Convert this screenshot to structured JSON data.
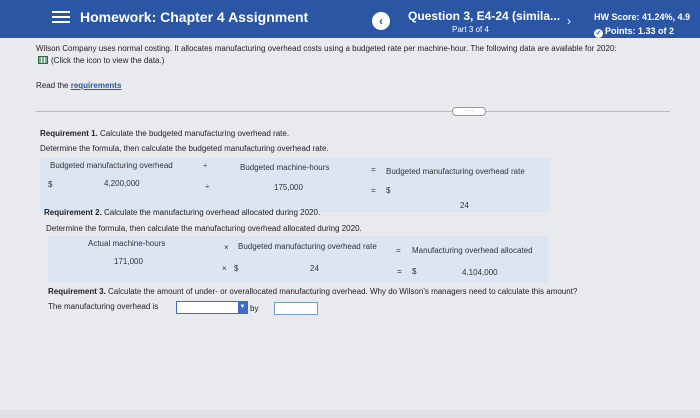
{
  "header": {
    "title": "Homework: Chapter 4 Assignment",
    "question_title": "Question 3, E4-24 (simila...",
    "question_part": "Part 3 of 4",
    "hw_score": "HW Score: 41.24%, 4.9",
    "points": "Points: 1.33 of 2",
    "prev_glyph": "‹",
    "next_glyph": "›"
  },
  "problem": {
    "intro": "Wilson Company uses normal costing. It allocates manufacturing overhead costs using a budgeted rate per machine-hour. The following data are available for 2020:",
    "data_link": "(Click the icon to view the data.)",
    "read_the": "Read the",
    "requirements_link": "requirements",
    "expand_label": "·····"
  },
  "req1": {
    "heading": "Requirement 1.",
    "heading_text": "Calculate the budgeted manufacturing overhead rate.",
    "formula_prompt": "Determine the formula, then calculate the budgeted manufacturing overhead rate.",
    "col1_label": "Budgeted manufacturing overhead",
    "op1": "÷",
    "col2_label": "Budgeted machine-hours",
    "eq": "=",
    "col3_label": "Budgeted manufacturing overhead rate",
    "row_dollar1": "$",
    "val1": "4,200,000",
    "op1b": "÷",
    "val2": "175,000",
    "eq_b": "=",
    "row_dollar2": "$",
    "val3": "24"
  },
  "req2": {
    "heading": "Requirement 2.",
    "heading_text": "Calculate the manufacturing overhead allocated during 2020.",
    "formula_prompt": "Determine the formula, then calculate the manufacturing overhead allocated during 2020.",
    "col1_label": "Actual machine-hours",
    "op": "×",
    "col2_label": "Budgeted manufacturing overhead rate",
    "eq": "=",
    "col3_label": "Manufacturing overhead allocated",
    "val1": "171,000",
    "op_b": "×",
    "dollar2": "$",
    "val2": "24",
    "eq_b": "=",
    "dollar3": "$",
    "val3": "4,104,000"
  },
  "req3": {
    "heading": "Requirement 3.",
    "heading_text": "Calculate the amount of under- or overallocated manufacturing overhead. Why do Wilson's managers need to calculate this amount?",
    "sentence_start": "The manufacturing overhead is",
    "by": "by"
  }
}
